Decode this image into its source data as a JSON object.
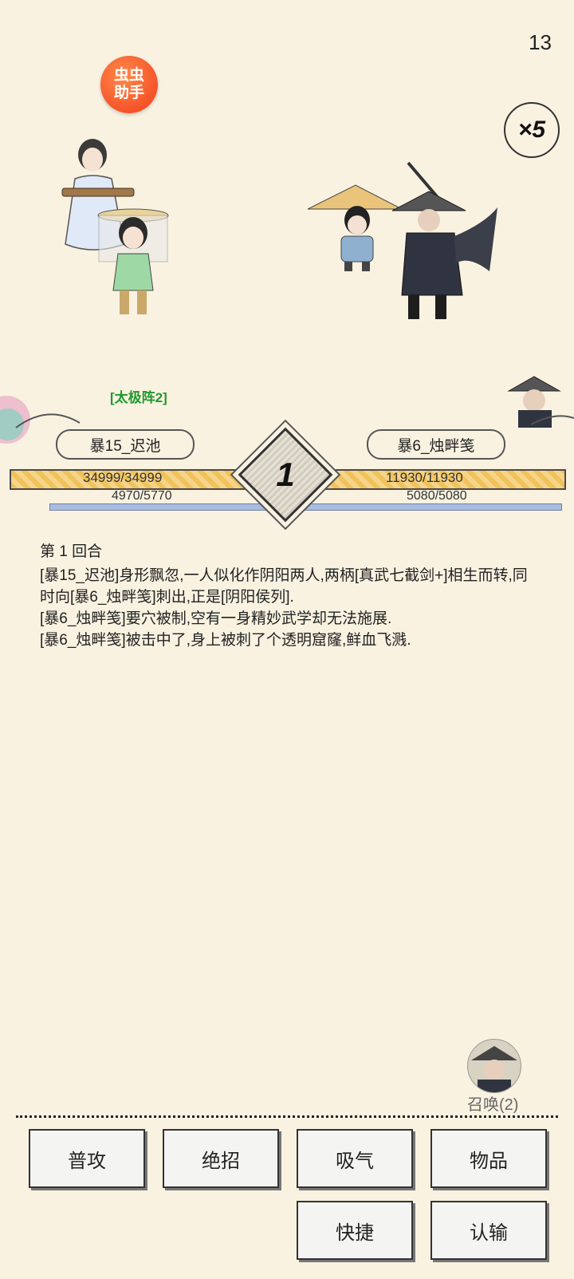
{
  "status": {
    "counter": "13"
  },
  "helper_badge": {
    "label": "虫虫\n助手"
  },
  "speed": {
    "label": "×5"
  },
  "battle": {
    "formation": "[太极阵2]",
    "turn": "1",
    "ally": {
      "name": "暴15_迟池",
      "hp_text": "34999/34999",
      "mp_text": "4970/5770",
      "hp_fraction": 1.0,
      "mp_fraction": 0.861
    },
    "enemy": {
      "name": "暴6_烛畔笺",
      "hp_text": "11930/11930",
      "mp_text": "5080/5080",
      "hp_fraction": 1.0,
      "mp_fraction": 1.0
    }
  },
  "log": {
    "lines": [
      "第 1 回合",
      "[暴15_迟池]身形飘忽,一人似化作阴阳两人,两柄[真武七截剑+]相生而转,同时向[暴6_烛畔笺]刺出,正是[阴阳侯列].",
      "[暴6_烛畔笺]要穴被制,空有一身精妙武学却无法施展.",
      "[暴6_烛畔笺]被击中了,身上被刺了个透明窟窿,鲜血飞溅."
    ]
  },
  "summon": {
    "label": "召唤(2)"
  },
  "actions": {
    "attack": "普攻",
    "ultimate": "绝招",
    "absorb": "吸气",
    "items": "物品",
    "quick": "快捷",
    "surrender": "认输"
  },
  "colors": {
    "background": "#f9f2e1",
    "hp": "#f0c25a",
    "mp": "#a9bde2",
    "formation": "#1e9a2c",
    "helper": "#f23c1c"
  }
}
